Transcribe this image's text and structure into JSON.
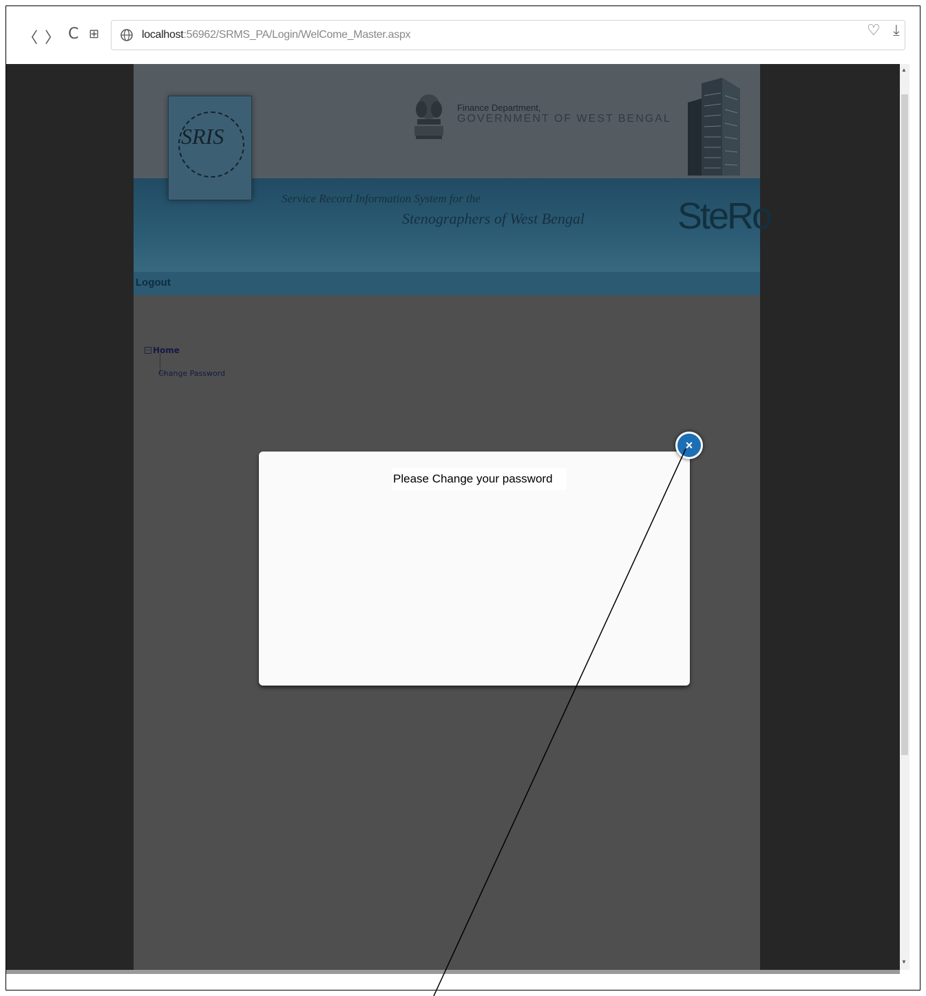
{
  "browser": {
    "url_host": "localhost",
    "url_path": ":56962/SRMS_PA/Login/WelCome_Master.aspx",
    "icons": [
      "back-icon",
      "forward-icon",
      "reload-icon",
      "grid-icon",
      "globe-icon",
      "heart-icon",
      "download-icon"
    ]
  },
  "header": {
    "logo_text": "SRIS",
    "dept_line1": "Finance Department,",
    "dept_line2": "GOVERNMENT OF WEST BENGAL",
    "tagline1": "Service Record Information System for the",
    "tagline2": "Stenographers of West Bengal",
    "brand": "SteRo"
  },
  "menu": {
    "logout": "Logout"
  },
  "tree": {
    "root": "Home",
    "child": "Change Password"
  },
  "modal": {
    "message": "Please Change your password",
    "close_label": "×"
  },
  "colors": {
    "overlay_page": "#4f4f4f",
    "band": "#2c5c75",
    "close_button": "#1c6fb5"
  }
}
